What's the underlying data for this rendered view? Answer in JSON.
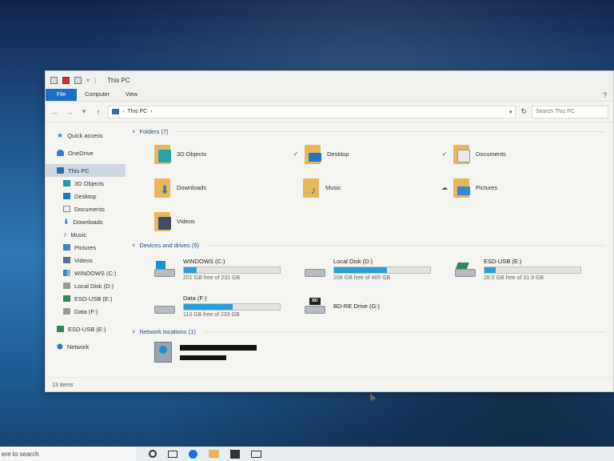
{
  "window": {
    "title": "This PC",
    "ribbon_tabs": [
      {
        "label": "File"
      },
      {
        "label": "Computer"
      },
      {
        "label": "View"
      }
    ],
    "help_icon": "help-icon",
    "address": {
      "crumb": "This PC",
      "separator": "›"
    },
    "search_placeholder": "Search This PC"
  },
  "sidebar": {
    "items": [
      {
        "label": "Quick access",
        "icon": "star-icon"
      },
      {
        "label": "OneDrive",
        "icon": "cloud-icon"
      },
      {
        "label": "This PC",
        "icon": "pc-icon",
        "selected": true
      },
      {
        "label": "3D Objects",
        "icon": "3d-objects-icon"
      },
      {
        "label": "Desktop",
        "icon": "desktop-icon"
      },
      {
        "label": "Documents",
        "icon": "documents-icon"
      },
      {
        "label": "Downloads",
        "icon": "download-icon"
      },
      {
        "label": "Music",
        "icon": "music-icon"
      },
      {
        "label": "Pictures",
        "icon": "pictures-icon"
      },
      {
        "label": "Videos",
        "icon": "videos-icon"
      },
      {
        "label": "WINDOWS (C:)",
        "icon": "drive-icon"
      },
      {
        "label": "Local Disk (D:)",
        "icon": "drive-icon"
      },
      {
        "label": "ESD-USB (E:)",
        "icon": "usb-drive-icon"
      },
      {
        "label": "Data (F:)",
        "icon": "drive-icon"
      },
      {
        "label": "ESD-USB (E:)",
        "icon": "usb-drive-icon"
      },
      {
        "label": "Network",
        "icon": "network-icon"
      }
    ]
  },
  "content": {
    "folders_header": "Folders (7)",
    "folders": [
      {
        "label": "3D Objects",
        "icon": "3d-objects-folder-icon"
      },
      {
        "label": "Desktop",
        "icon": "desktop-folder-icon",
        "status": "✓"
      },
      {
        "label": "Documents",
        "icon": "documents-folder-icon",
        "status": "✓"
      },
      {
        "label": "Downloads",
        "icon": "downloads-folder-icon"
      },
      {
        "label": "Music",
        "icon": "music-folder-icon"
      },
      {
        "label": "Pictures",
        "icon": "pictures-folder-icon",
        "status": "☁"
      },
      {
        "label": "Videos",
        "icon": "videos-folder-icon"
      }
    ],
    "drives_header": "Devices and drives (5)",
    "drives": [
      {
        "name": "WINDOWS (C:)",
        "free_text": "201 GB free of 231 GB",
        "used_fraction": 0.13,
        "has_bar": true
      },
      {
        "name": "Local Disk (D:)",
        "free_text": "208 GB free of 465 GB",
        "used_fraction": 0.55,
        "has_bar": true
      },
      {
        "name": "ESD-USB (E:)",
        "free_text": "28.0 GB free of 31.9 GB",
        "used_fraction": 0.12,
        "has_bar": true
      },
      {
        "name": "Data (F:)",
        "free_text": "113 GB free of 233 GB",
        "used_fraction": 0.51,
        "has_bar": true
      },
      {
        "name": "BD-RE Drive (G:)",
        "free_text": "",
        "used_fraction": 0,
        "has_bar": false
      }
    ],
    "network_header": "Network locations (1)"
  },
  "statusbar": {
    "text": "13 items"
  },
  "taskbar": {
    "search_text": "ere to search"
  },
  "colors": {
    "accent": "#1e6fc4",
    "drive_fill": "#26a0da",
    "folder": "#e8b65b"
  }
}
